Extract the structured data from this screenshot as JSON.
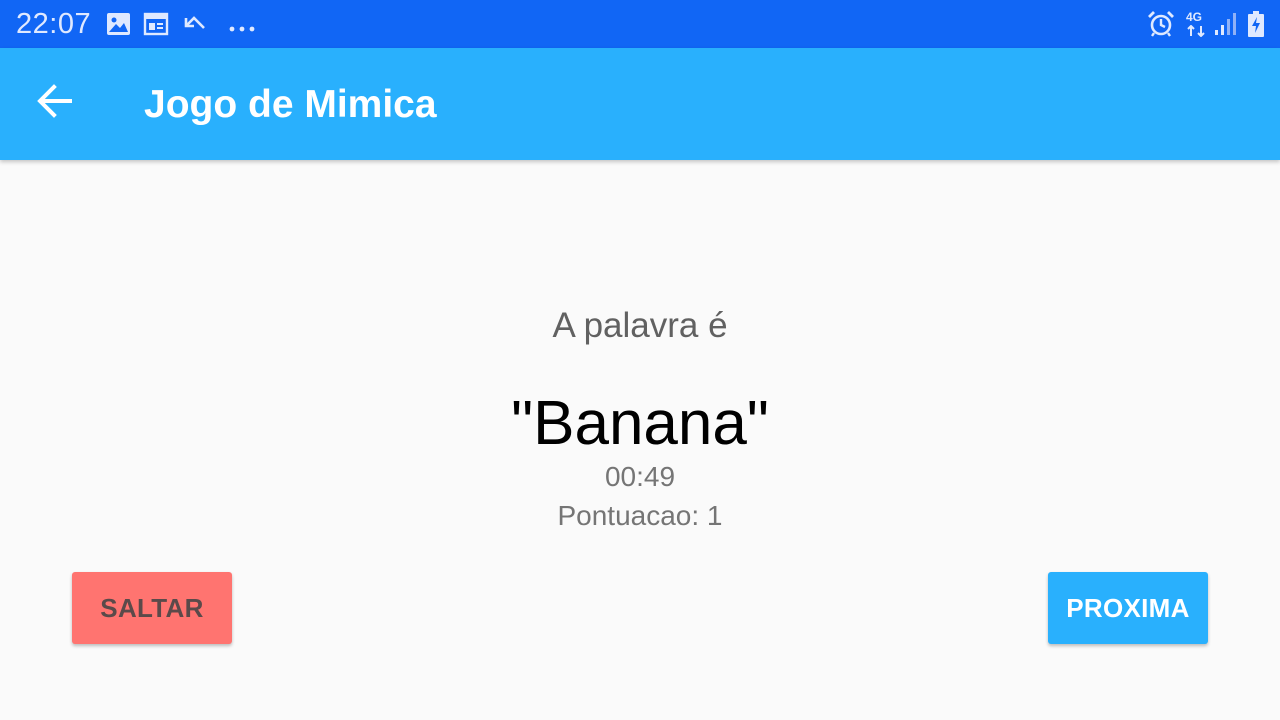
{
  "status_bar": {
    "time": "22:07",
    "network": "4G",
    "icons": [
      "image-icon",
      "calendar-icon",
      "missed-call-icon",
      "more-dots-icon",
      "alarm-icon",
      "network-4g-icon",
      "signal-icon",
      "battery-charging-icon"
    ],
    "background_color": "#1166f5"
  },
  "app_bar": {
    "title": "Jogo de Mimica",
    "back_icon": "arrow-left-icon",
    "background_color": "#29b0fd"
  },
  "game": {
    "prompt": "A palavra é",
    "word": "\"Banana\"",
    "timer": "00:49",
    "score": "Pontuacao: 1"
  },
  "buttons": {
    "skip_label": "SALTAR",
    "skip_color": "#ff7470",
    "next_label": "PROXIMA",
    "next_color": "#29b0fd"
  }
}
